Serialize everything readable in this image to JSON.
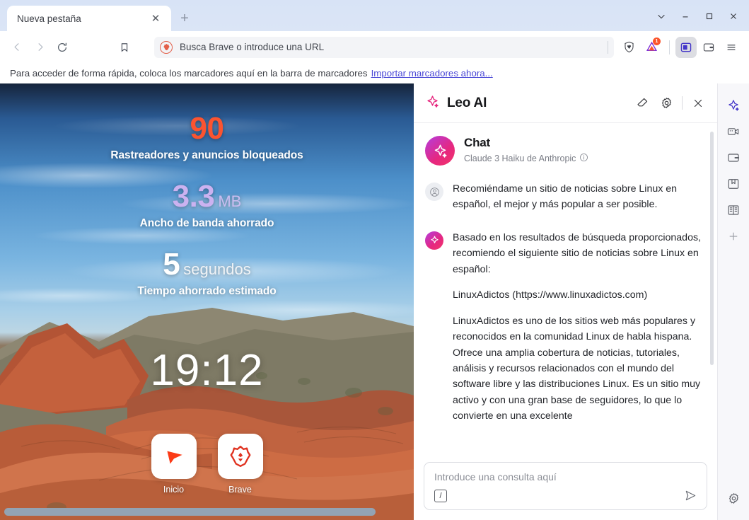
{
  "window": {
    "controls": [
      {
        "name": "tab-search",
        "label": "⌄"
      },
      {
        "name": "minimize",
        "label": "—"
      },
      {
        "name": "maximize",
        "label": "□"
      },
      {
        "name": "close",
        "label": "✕"
      }
    ]
  },
  "tabstrip": {
    "tabs": [
      {
        "title": "Nueva pestaña",
        "close_label": "✕"
      }
    ],
    "new_tab_label": "+"
  },
  "navbar": {
    "back_label": "‹",
    "forward_label": "›",
    "reload_label": "↻",
    "bookmark_label": "☆",
    "omnibox_placeholder": "Busca Brave o introduce una URL",
    "shields_name": "brave-shields-icon",
    "rewards_name": "brave-rewards-icon",
    "rewards_badge": "1",
    "sidebar_toggle_name": "sidebar-toggle-icon",
    "wallet_name": "brave-wallet-icon",
    "menu_label": "≡"
  },
  "bookmarkbar": {
    "hint": "Para acceder de forma rápida, coloca los marcadores aquí en la barra de marcadores",
    "import_link": "Importar marcadores ahora..."
  },
  "newtab": {
    "stats": [
      {
        "value": "90",
        "unit": "",
        "label": "Rastreadores y anuncios bloqueados",
        "color_class": "orange"
      },
      {
        "value": "3.3",
        "unit": "MB",
        "label": "Ancho de banda ahorrado",
        "color_class": "purple"
      },
      {
        "value": "5",
        "unit": "segundos",
        "label": "Tiempo ahorrado estimado",
        "color_class": "white"
      }
    ],
    "clock": "19:12",
    "shortcuts": [
      {
        "label": "Inicio",
        "icon": "cursor-arrow-icon"
      },
      {
        "label": "Brave",
        "icon": "brave-lion-icon"
      }
    ]
  },
  "leo": {
    "title": "Leo AI",
    "header_actions": [
      {
        "name": "erase-conversation-icon",
        "label": "◇"
      },
      {
        "name": "settings-gear-icon",
        "label": "⚙"
      },
      {
        "name": "close-icon",
        "label": "✕"
      }
    ],
    "chat_title": "Chat",
    "model": "Claude 3 Haiku de Anthropic",
    "info_label": "ⓘ",
    "messages": [
      {
        "role": "user",
        "paragraphs": [
          "Recomiéndame un sitio de noticias sobre Linux en español, el mejor y más popular a ser posible."
        ]
      },
      {
        "role": "assistant",
        "paragraphs": [
          "Basado en los resultados de búsqueda proporcionados, recomiendo el siguiente sitio de noticias sobre Linux en español:",
          "LinuxAdictos (https://www.linuxadictos.com)",
          "LinuxAdictos es uno de los sitios web más populares y reconocidos en la comunidad Linux de habla hispana. Ofrece una amplia cobertura de noticias, tutoriales, análisis y recursos relacionados con el mundo del software libre y las distribuciones Linux. Es un sitio muy activo y con una gran base de seguidores, lo que lo convierte en una excelente"
        ]
      }
    ],
    "input_placeholder": "Introduce una consulta aquí",
    "slash_key": "/",
    "send_label": "➤"
  },
  "rail": {
    "items": [
      {
        "name": "sidebar-item-leo-ai",
        "icon": "sparkle-icon",
        "selected": true
      },
      {
        "name": "sidebar-item-talk",
        "icon": "video-camera-icon",
        "selected": false
      },
      {
        "name": "sidebar-item-wallet",
        "icon": "wallet-icon",
        "selected": false
      },
      {
        "name": "sidebar-item-bookmarks",
        "icon": "bookmarks-icon",
        "selected": false
      },
      {
        "name": "sidebar-item-reading-list",
        "icon": "reading-list-icon",
        "selected": false
      },
      {
        "name": "sidebar-item-add",
        "icon": "plus-icon",
        "selected": false
      }
    ],
    "settings_icon": "gear-icon"
  },
  "colors": {
    "brave_orange": "#fb5430",
    "accent_purple": "#4436c9",
    "leo_pink": "#e6277f",
    "link_blue": "#4b49d6"
  }
}
